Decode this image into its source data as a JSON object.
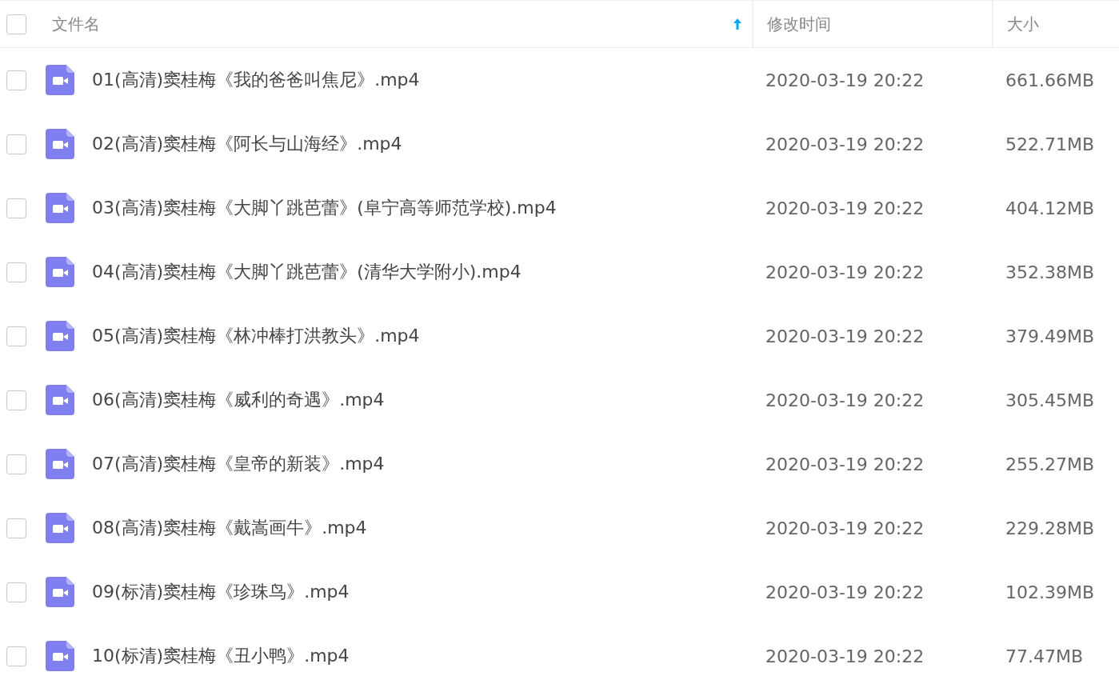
{
  "header": {
    "checked": false,
    "columns": [
      {
        "label": "文件名",
        "sorted": true
      },
      {
        "label": "修改时间",
        "sorted": false
      },
      {
        "label": "大小",
        "sorted": false
      }
    ]
  },
  "files": [
    {
      "name": "01(高清)窦桂梅《我的爸爸叫焦尼》.mp4",
      "modified": "2020-03-19 20:22",
      "size": "661.66MB",
      "kind": "video",
      "checked": false
    },
    {
      "name": "02(高清)窦桂梅《阿长与山海经》.mp4",
      "modified": "2020-03-19 20:22",
      "size": "522.71MB",
      "kind": "video",
      "checked": false
    },
    {
      "name": "03(高清)窦桂梅《大脚丫跳芭蕾》(阜宁高等师范学校).mp4",
      "modified": "2020-03-19 20:22",
      "size": "404.12MB",
      "kind": "video",
      "checked": false
    },
    {
      "name": "04(高清)窦桂梅《大脚丫跳芭蕾》(清华大学附小).mp4",
      "modified": "2020-03-19 20:22",
      "size": "352.38MB",
      "kind": "video",
      "checked": false
    },
    {
      "name": "05(高清)窦桂梅《林冲棒打洪教头》.mp4",
      "modified": "2020-03-19 20:22",
      "size": "379.49MB",
      "kind": "video",
      "checked": false
    },
    {
      "name": "06(高清)窦桂梅《威利的奇遇》.mp4",
      "modified": "2020-03-19 20:22",
      "size": "305.45MB",
      "kind": "video",
      "checked": false
    },
    {
      "name": "07(高清)窦桂梅《皇帝的新装》.mp4",
      "modified": "2020-03-19 20:22",
      "size": "255.27MB",
      "kind": "video",
      "checked": false
    },
    {
      "name": "08(高清)窦桂梅《戴嵩画牛》.mp4",
      "modified": "2020-03-19 20:22",
      "size": "229.28MB",
      "kind": "video",
      "checked": false
    },
    {
      "name": "09(标清)窦桂梅《珍珠鸟》.mp4",
      "modified": "2020-03-19 20:22",
      "size": "102.39MB",
      "kind": "video",
      "checked": false
    },
    {
      "name": "10(标清)窦桂梅《丑小鸭》.mp4",
      "modified": "2020-03-19 20:22",
      "size": "77.47MB",
      "kind": "video",
      "checked": false
    }
  ]
}
